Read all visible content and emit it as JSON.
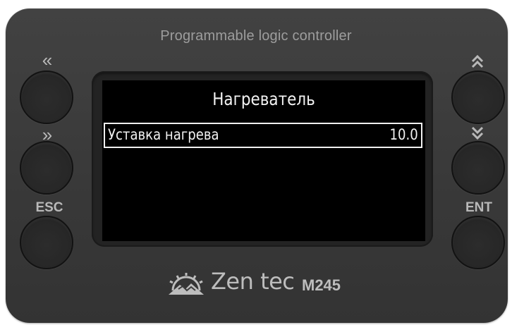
{
  "device": {
    "title": "Programmable logic controller",
    "brand": "Zen tec",
    "model": "M245"
  },
  "buttons": {
    "left": [
      {
        "label": "«",
        "icon": "double-chevron-left"
      },
      {
        "label": "»",
        "icon": "double-chevron-right"
      },
      {
        "label": "ESC",
        "icon": ""
      }
    ],
    "right": [
      {
        "label": "⌃⌃",
        "icon": "double-chevron-up"
      },
      {
        "label": "⌄⌄",
        "icon": "double-chevron-down"
      },
      {
        "label": "ENT",
        "icon": ""
      }
    ]
  },
  "screen": {
    "title": "Нагреватель",
    "items": [
      {
        "label": "Уставка нагрева",
        "value": "10.0",
        "selected": true
      }
    ]
  },
  "colors": {
    "body": "#3b3b3b",
    "screen": "#000000",
    "text": "#f2f2f2",
    "label": "#b9b9b9"
  }
}
